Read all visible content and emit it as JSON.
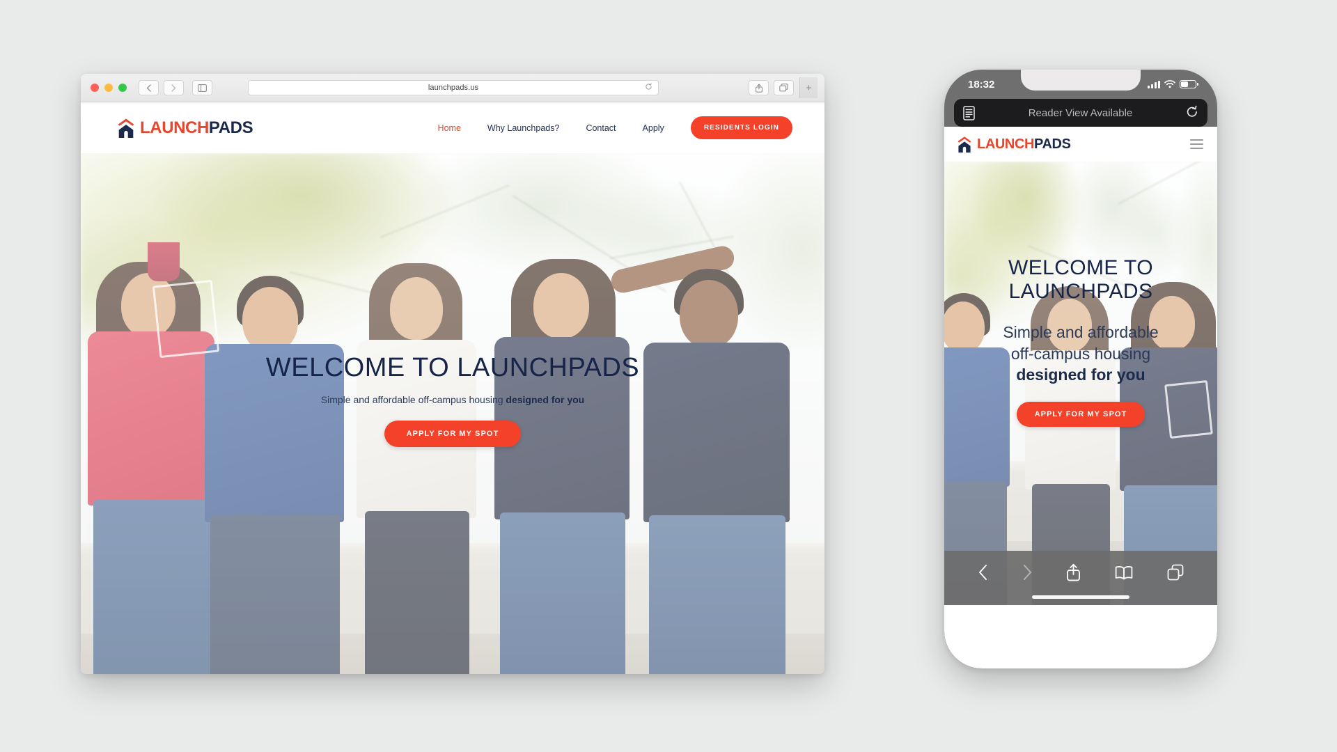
{
  "desktop": {
    "browser": {
      "url": "launchpads.us",
      "traffic_lights": [
        "close",
        "minimize",
        "zoom"
      ],
      "back_icon": "chevron-left-icon",
      "forward_icon": "chevron-right-icon",
      "sidebar_icon": "sidebar-icon",
      "reload_icon": "reload-icon",
      "share_icon": "share-icon",
      "tabs_icon": "tabs-icon",
      "newtab_label": "+"
    },
    "site": {
      "logo": {
        "icon": "house-icon",
        "launch": "LAUNCH",
        "pads": "PADS"
      },
      "nav": [
        {
          "label": "Home",
          "active": true
        },
        {
          "label": "Why Launchpads?",
          "active": false
        },
        {
          "label": "Contact",
          "active": false
        },
        {
          "label": "Apply",
          "active": false
        }
      ],
      "login_label": "RESIDENTS LOGIN",
      "hero": {
        "title": "WELCOME TO LAUNCHPADS",
        "sub_plain": "Simple and affordable off-campus housing ",
        "sub_bold": "designed for you",
        "cta_label": "APPLY FOR MY SPOT"
      }
    }
  },
  "phone": {
    "status": {
      "time": "18:32",
      "signal_icon": "cellular-signal-icon",
      "wifi_icon": "wifi-icon",
      "battery_icon": "battery-icon"
    },
    "reader_bar": {
      "reader_icon": "reader-view-icon",
      "title": "Reader View Available",
      "reload_icon": "reload-icon"
    },
    "site": {
      "logo": {
        "icon": "house-icon",
        "launch": "LAUNCH",
        "pads": "PADS"
      },
      "menu_icon": "hamburger-menu-icon",
      "hero": {
        "title_line1": "WELCOME TO",
        "title_line2": "LAUNCHPADS",
        "sub_line1": "Simple and affordable",
        "sub_line2": "off-campus housing",
        "sub_bold": "designed for you",
        "cta_label": "APPLY FOR MY SPOT"
      }
    },
    "toolbar": [
      {
        "icon": "back-icon"
      },
      {
        "icon": "forward-icon"
      },
      {
        "icon": "share-icon"
      },
      {
        "icon": "bookmarks-icon"
      },
      {
        "icon": "tabs-icon"
      }
    ]
  },
  "colors": {
    "brand_red": "#f3412a",
    "brand_navy": "#1b2a4a",
    "page_background": "#e9eaea",
    "phone_frame": "#6f6f6f"
  }
}
